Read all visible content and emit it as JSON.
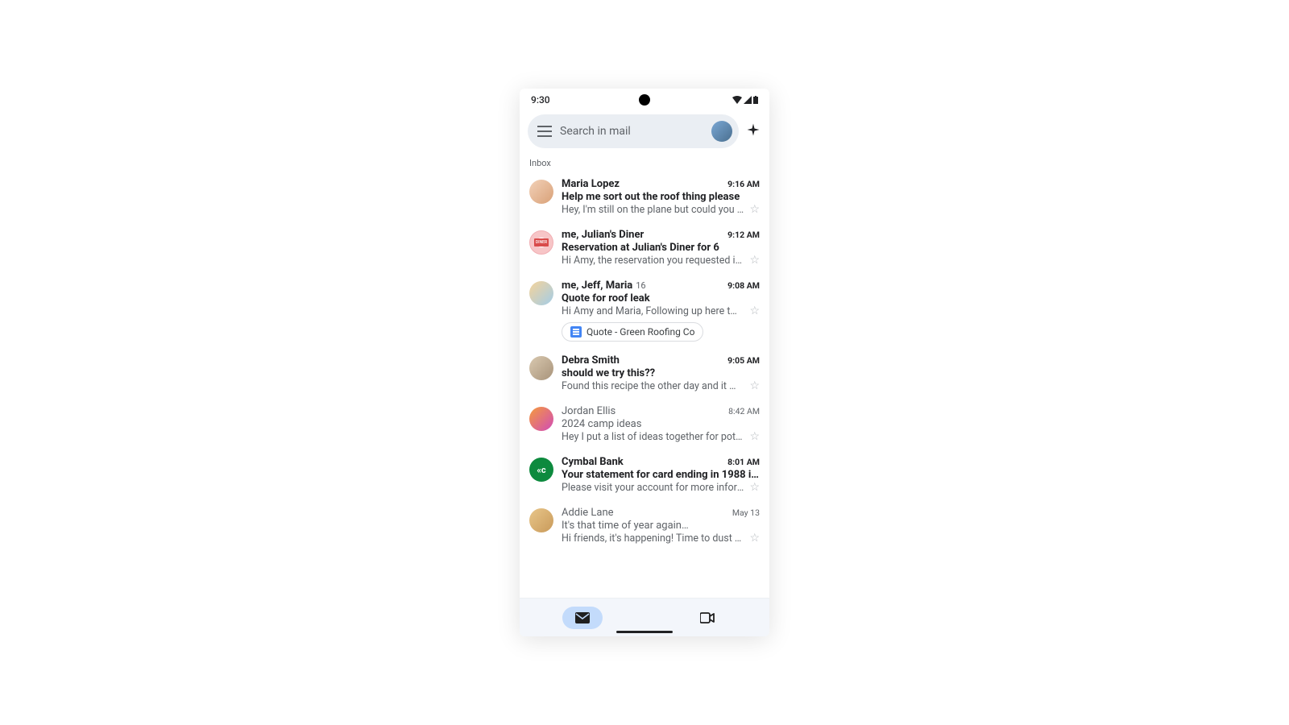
{
  "statusBar": {
    "time": "9:30"
  },
  "search": {
    "placeholder": "Search in mail"
  },
  "sectionLabel": "Inbox",
  "emails": [
    {
      "sender": "Maria Lopez",
      "senderHtml": "Maria Lopez",
      "time": "9:16 AM",
      "subject": "Help me sort out the roof thing please",
      "snippet": "Hey, I'm still on the plane but could you repl…",
      "unread": true,
      "avatarClass": "av-maria",
      "threadCount": ""
    },
    {
      "sender": "me, Julian's Diner",
      "senderHtml": "me, <span class=\"bold\">Julian's Diner</span>",
      "time": "9:12 AM",
      "subject": "Reservation at Julian's Diner for 6",
      "snippet": "Hi Amy, the reservation you requested is now",
      "unread": true,
      "avatarClass": "av-diner",
      "avatarInner": "diner",
      "threadCount": ""
    },
    {
      "sender": "me, Jeff, Maria",
      "senderHtml": "me, Jeff, <span class=\"bold\">Maria</span>",
      "time": "9:08 AM",
      "subject": "Quote for roof leak",
      "snippet": "Hi Amy and Maria, Following up here t…",
      "unread": true,
      "avatarClass": "av-jeff",
      "threadCount": "16",
      "attachment": "Quote - Green Roofing Co"
    },
    {
      "sender": "Debra Smith",
      "senderHtml": "Debra Smith",
      "time": "9:05 AM",
      "subject": "should we try this??",
      "snippet": "Found this recipe the other day and it might…",
      "unread": true,
      "avatarClass": "av-debra",
      "threadCount": ""
    },
    {
      "sender": "Jordan Ellis",
      "senderHtml": "Jordan Ellis",
      "time": "8:42 AM",
      "subject": "2024 camp ideas",
      "snippet": "Hey I put a list of ideas together for potenti…",
      "unread": false,
      "avatarClass": "av-jordan",
      "threadCount": ""
    },
    {
      "sender": "Cymbal Bank",
      "senderHtml": "Cymbal Bank",
      "time": "8:01 AM",
      "subject": "Your statement for card ending in 1988 i…",
      "snippet": "Please visit your account for more informati…",
      "unread": true,
      "avatarClass": "av-cymbal",
      "avatarText": "«c",
      "threadCount": ""
    },
    {
      "sender": "Addie Lane",
      "senderHtml": "Addie Lane",
      "time": "May 13",
      "subject": "It's that time of year again…",
      "snippet": "Hi friends, it's happening! Time to dust off y…",
      "unread": false,
      "avatarClass": "av-addie",
      "threadCount": ""
    }
  ]
}
